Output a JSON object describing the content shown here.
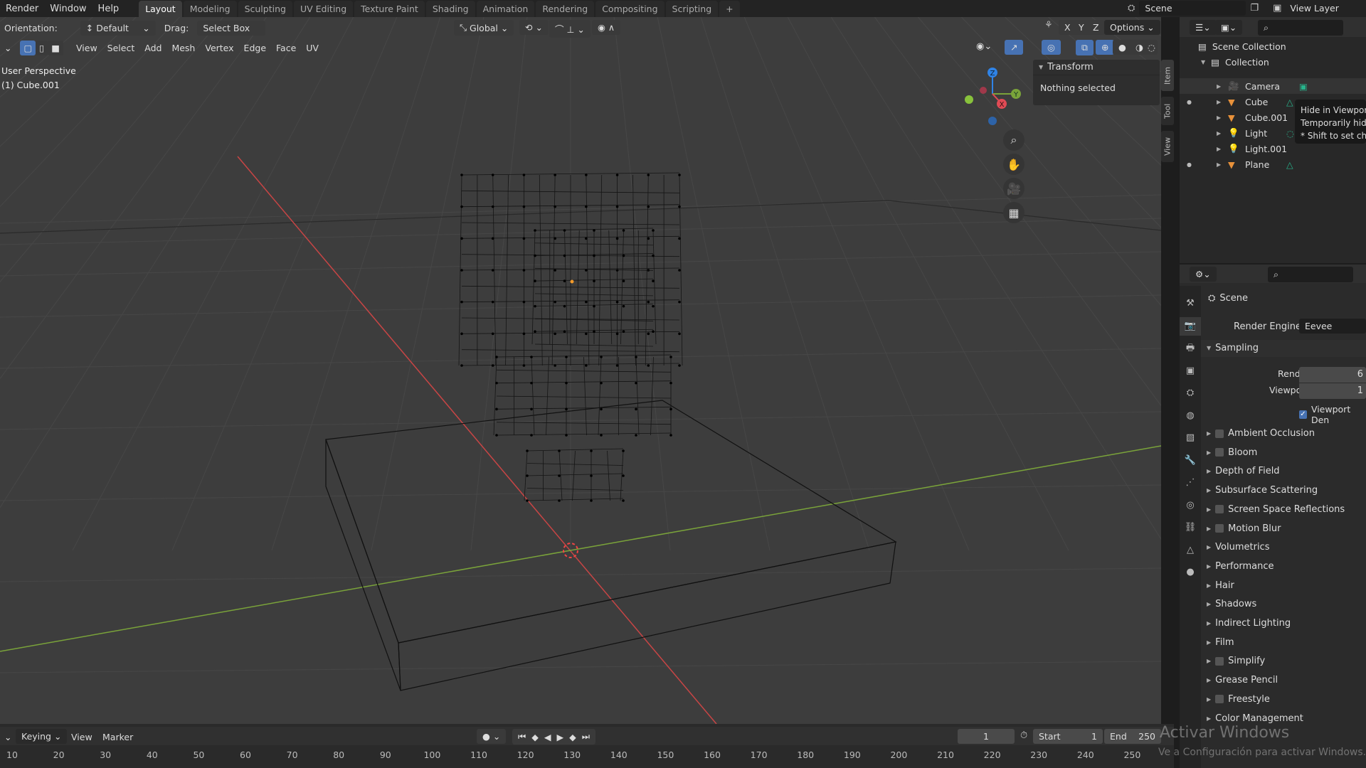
{
  "menu": [
    "Render",
    "Window",
    "Help"
  ],
  "workspaces": [
    "Layout",
    "Modeling",
    "Sculpting",
    "UV Editing",
    "Texture Paint",
    "Shading",
    "Animation",
    "Rendering",
    "Compositing",
    "Scripting",
    "+"
  ],
  "active_workspace": "Layout",
  "scene": {
    "name": "Scene",
    "view_layer": "View Layer"
  },
  "tool_settings": {
    "orientation_label": "Orientation:",
    "orientation": "Default",
    "drag_label": "Drag:",
    "drag": "Select Box",
    "transform_orientation": "Global",
    "options": "Options",
    "axes": [
      "X",
      "Y",
      "Z"
    ]
  },
  "viewport_menu": [
    "View",
    "Select",
    "Add",
    "Mesh",
    "Vertex",
    "Edge",
    "Face",
    "UV"
  ],
  "viewport": {
    "view_name": "User Perspective",
    "object_name": "(1) Cube.001",
    "view_name_visible": "Perspective",
    "object_name_visible": "ube.001"
  },
  "gizmo": {
    "x": "X",
    "y": "Y",
    "z": "Z"
  },
  "npanel": {
    "header": "Transform",
    "body": "Nothing selected",
    "tabs": [
      "Item",
      "Tool",
      "View"
    ]
  },
  "outliner": {
    "root": "Scene Collection",
    "collection": "Collection",
    "items": [
      {
        "name": "Camera",
        "icon": "camera-icon"
      },
      {
        "name": "Cube",
        "icon": "mesh-icon"
      },
      {
        "name": "Cube.001",
        "icon": "mesh-icon"
      },
      {
        "name": "Light",
        "icon": "light-icon"
      },
      {
        "name": "Light.001",
        "icon": "light-icon"
      },
      {
        "name": "Plane",
        "icon": "mesh-icon"
      }
    ]
  },
  "tooltip": [
    "Hide in Viewpor",
    "Temporarily hid",
    "* Shift to set ch"
  ],
  "properties": {
    "context": "Scene",
    "render_engine_label": "Render Engine",
    "render_engine": "Eevee",
    "sampling": "Sampling",
    "render_label": "Render",
    "render_value": "6",
    "viewport_label": "Viewport",
    "viewport_value": "1",
    "viewport_denoise": "Viewport Den",
    "panels": [
      {
        "label": "Ambient Occlusion",
        "checkbox": true
      },
      {
        "label": "Bloom",
        "checkbox": true
      },
      {
        "label": "Depth of Field",
        "checkbox": false
      },
      {
        "label": "Subsurface Scattering",
        "checkbox": false
      },
      {
        "label": "Screen Space Reflections",
        "checkbox": true
      },
      {
        "label": "Motion Blur",
        "checkbox": true
      },
      {
        "label": "Volumetrics",
        "checkbox": false
      },
      {
        "label": "Performance",
        "checkbox": false
      },
      {
        "label": "Hair",
        "checkbox": false
      },
      {
        "label": "Shadows",
        "checkbox": false
      },
      {
        "label": "Indirect Lighting",
        "checkbox": false
      },
      {
        "label": "Film",
        "checkbox": false
      },
      {
        "label": "Simplify",
        "checkbox": true
      },
      {
        "label": "Grease Pencil",
        "checkbox": false
      },
      {
        "label": "Freestyle",
        "checkbox": true
      },
      {
        "label": "Color Management",
        "checkbox": false
      }
    ]
  },
  "timeline": {
    "menu": [
      "Keying",
      "View",
      "Marker"
    ],
    "current_frame": "1",
    "start_label": "Start",
    "start": "1",
    "end_label": "End",
    "end": "250",
    "ticks": [
      "10",
      "20",
      "30",
      "40",
      "50",
      "60",
      "70",
      "80",
      "90",
      "100",
      "110",
      "120",
      "130",
      "140",
      "150",
      "160",
      "170",
      "180",
      "190",
      "200",
      "210",
      "220",
      "230",
      "240",
      "250"
    ]
  },
  "watermark": {
    "title": "Activar Windows",
    "subtitle": "Ve a Configuración para activar Windows."
  },
  "colors": {
    "x_axis": "#c84545",
    "y_axis": "#7aa33a",
    "accent": "#4772b3",
    "object_orange": "#e8913a",
    "data_green": "#27b38b"
  }
}
